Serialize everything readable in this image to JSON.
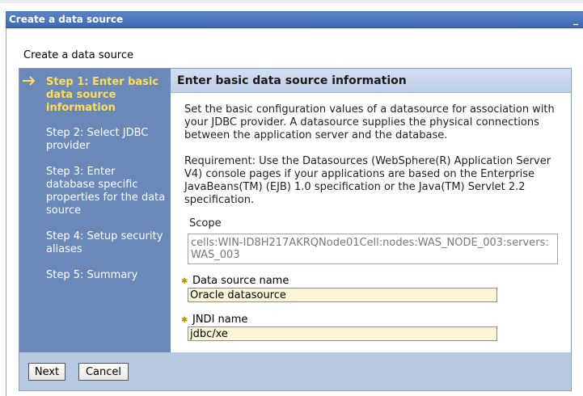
{
  "window": {
    "title": "Create a data source",
    "minimize_glyph": "_"
  },
  "page": {
    "heading": "Create a data source"
  },
  "steps": [
    {
      "label": "Step 1: Enter basic data source information",
      "current": true
    },
    {
      "label": "Step 2: Select JDBC provider",
      "current": false
    },
    {
      "label": "Step 3: Enter database specific properties for the data source",
      "current": false
    },
    {
      "label": "Step 4: Setup security aliases",
      "current": false
    },
    {
      "label": "Step 5: Summary",
      "current": false
    }
  ],
  "current_step_icon": "arrow-right-icon",
  "content": {
    "header": "Enter basic data source information",
    "description": "Set the basic configuration values of a datasource for association with your JDBC provider. A datasource supplies the physical connections between the application server and the database.",
    "requirement": "Requirement: Use the Datasources (WebSphere(R) Application Server V4) console pages if your applications are based on the Enterprise JavaBeans(TM) (EJB) 1.0 specification or the Java(TM) Servlet 2.2 specification.",
    "scope_label": "Scope",
    "scope_value": "cells:WIN-ID8H217AKRQNode01Cell:nodes:WAS_NODE_003:servers:WAS_003",
    "fields": {
      "data_source_name": {
        "label": "Data source name",
        "value": "Oracle datasource",
        "required": true
      },
      "jndi_name": {
        "label": "JNDI name",
        "value": "jdbc/xe",
        "required": true
      }
    },
    "required_icon": "required-star-icon"
  },
  "buttons": {
    "next": "Next",
    "cancel": "Cancel"
  },
  "colors": {
    "title_bar": "#4a74bb",
    "steps_panel": "#6b89b8",
    "current_step": "#ffde5a",
    "input_background": "#fdf6d6",
    "button_bar": "#b8c9e2"
  }
}
